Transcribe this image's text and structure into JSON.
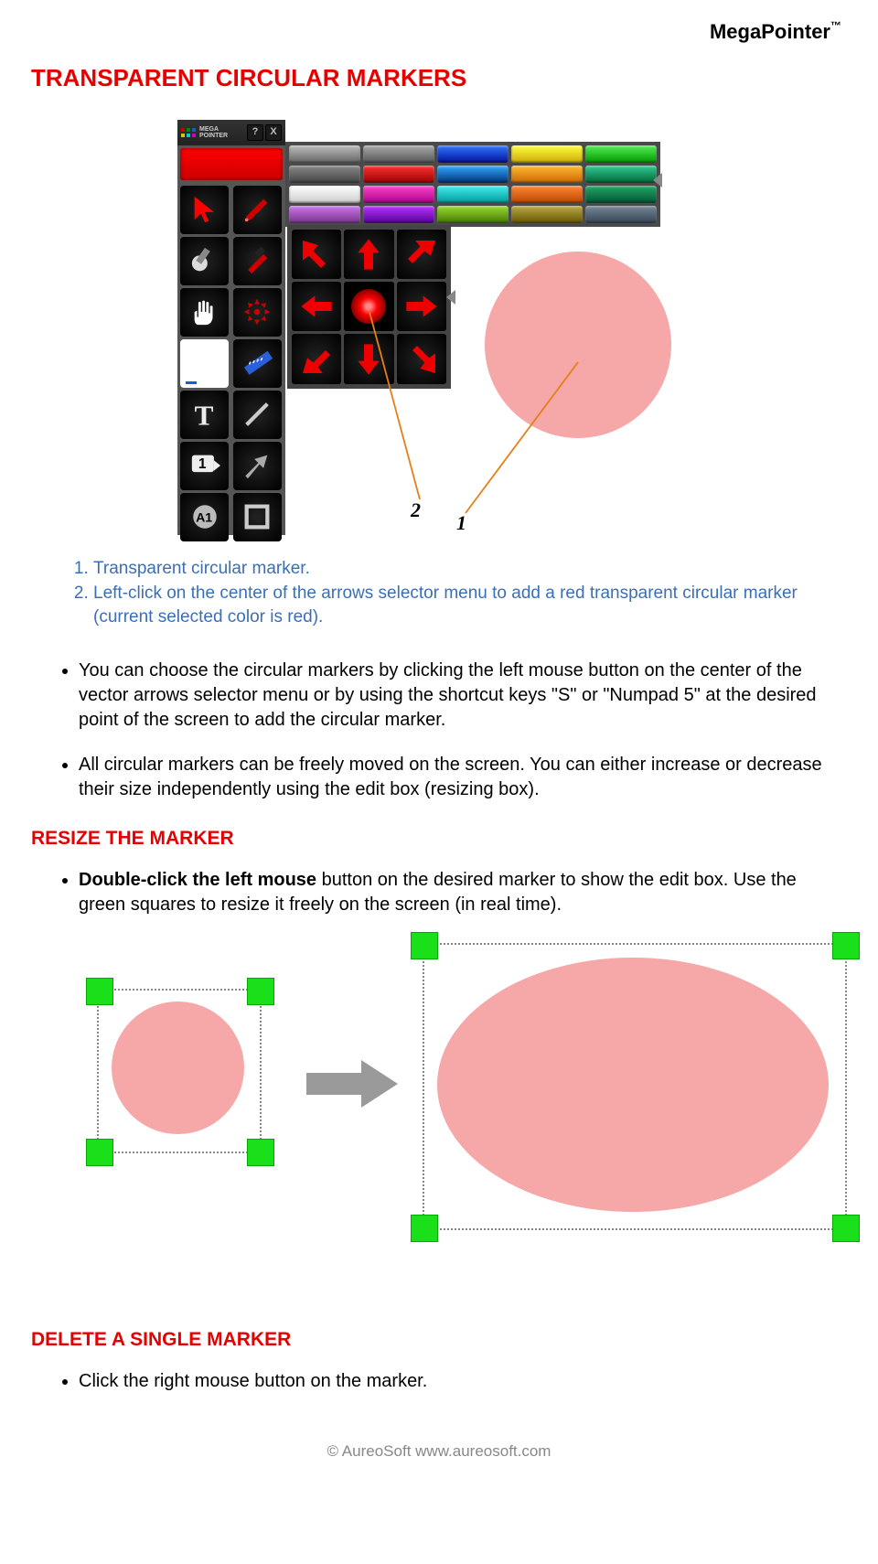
{
  "brand": {
    "name": "MegaPointer",
    "tm": "™"
  },
  "title": "TRANSPARENT CIRCULAR MARKERS",
  "toolbar_logo": {
    "l1": "MEGA",
    "l2": "POINTER"
  },
  "toolbar_help": "?",
  "toolbar_close": "X",
  "color_swatches": [
    "#888",
    "#888",
    "#14f",
    "#ee0",
    "#1c4",
    "#6a6a6a",
    "#c00",
    "#08c",
    "#e80",
    "#0a6",
    "#fff",
    "#f2f",
    "#1cc",
    "#e60",
    "#074",
    "#b5d",
    "#a0e",
    "#6c0",
    "#980",
    "#567"
  ],
  "callout": {
    "one": "1",
    "two": "2"
  },
  "legend": {
    "one": "Transparent circular marker.",
    "two": "Left-click on the center of the arrows selector menu to add a red transparent circular marker (current selected color is red)."
  },
  "bullets": {
    "a": "You can choose the circular markers by clicking the left mouse button on the center of the vector arrows selector menu or by using the shortcut keys \"S\" or \"Numpad 5\" at the desired point of the screen to add the circular marker.",
    "b": "All circular markers can be freely moved on the screen. You can either increase or decrease their size independently using the edit box (resizing box)."
  },
  "resize": {
    "heading": "RESIZE THE MARKER",
    "text_bold": "Double-click the left mouse",
    "text_rest": " button on the desired marker to show the edit box. Use the green squares to resize it freely on the screen (in real time)."
  },
  "delete": {
    "heading": "DELETE A SINGLE MARKER",
    "text": "Click the right mouse button on the marker."
  },
  "footer": {
    "copy": "© AureoSoft www.aureosoft.com"
  },
  "icons": {
    "badge1": "1",
    "badgeA1": "A1"
  }
}
